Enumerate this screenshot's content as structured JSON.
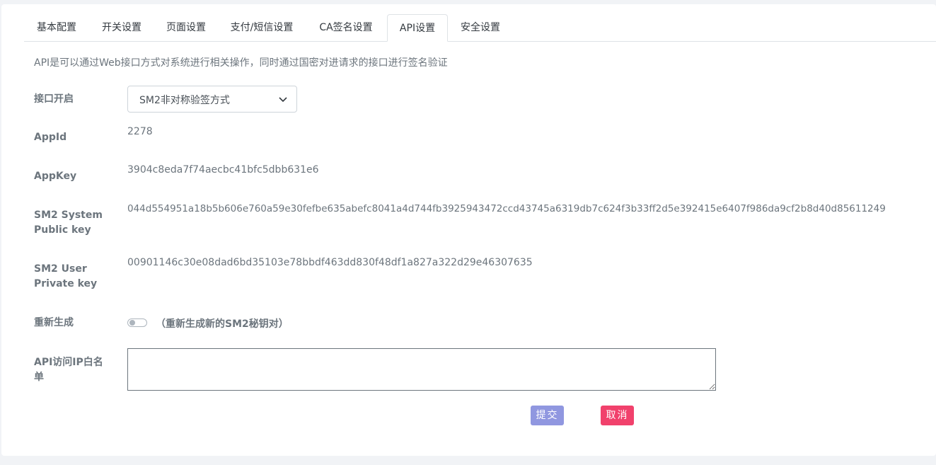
{
  "tabs": [
    {
      "label": "基本配置"
    },
    {
      "label": "开关设置"
    },
    {
      "label": "页面设置"
    },
    {
      "label": "支付/短信设置"
    },
    {
      "label": "CA签名设置"
    },
    {
      "label": "API设置",
      "active": true
    },
    {
      "label": "安全设置"
    }
  ],
  "description": "API是可以通过Web接口方式对系统进行相关操作，同时通过国密对进请求的接口进行签名验证",
  "form": {
    "interface_label": "接口开启",
    "interface_value": "SM2非对称验签方式",
    "appid_label": "AppId",
    "appid_value": "2278",
    "appkey_label": "AppKey",
    "appkey_value": "3904c8eda7f74aecbc41bfc5dbb631e6",
    "pubkey_label_1": "SM2 System",
    "pubkey_label_2": "Public key",
    "pubkey_value": "044d554951a18b5b606e760a59e30fefbe635abefc8041a4d744fb3925943472ccd43745a6319db7c624f3b33ff2d5e392415e6407f986da9cf2b8d40d85611249",
    "privkey_label_1": "SM2 User",
    "privkey_label_2": "Private key",
    "privkey_value": "00901146c30e08dad6bd35103e78bbdf463dd830f48df1a827a322d29e46307635",
    "regen_label": "重新生成",
    "regen_note": "（重新生成新的SM2秘钥对）",
    "regen_on": false,
    "whitelist_label_1": "API访问IP白名",
    "whitelist_label_2": "单",
    "whitelist_value": ""
  },
  "buttons": {
    "submit": "提交",
    "cancel": "取消"
  },
  "colors": {
    "submit": "#9097e0",
    "cancel": "#f1416c"
  },
  "icons": {
    "select_chevron": "chevron-down-icon"
  }
}
